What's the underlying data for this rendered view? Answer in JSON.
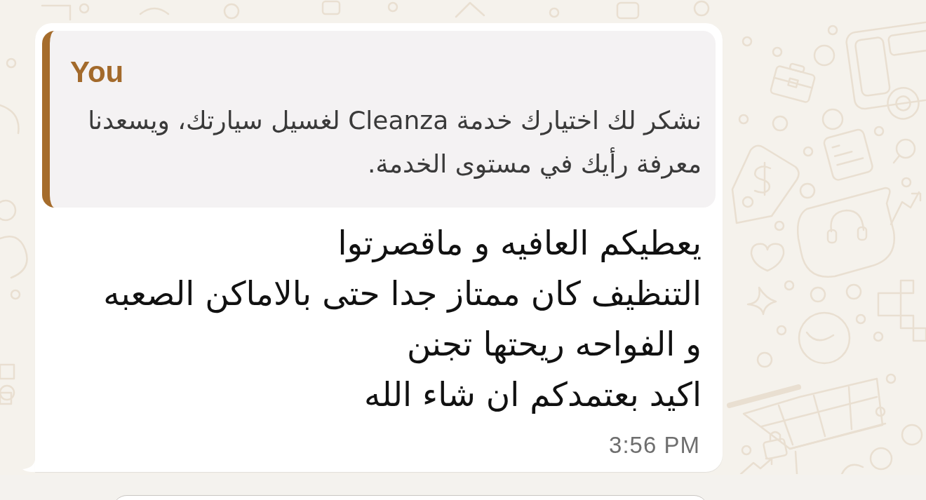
{
  "message": {
    "quote": {
      "author": "You",
      "text": "نشكر لك اختيارك خدمة Cleanza لغسيل سيارتك، ويسعدنا معرفة رأيك في مستوى الخدمة."
    },
    "text": "يعطيكم العافيه و ماقصرتوا\nالتنظيف كان ممتاز جدا حتى بالاماكن الصعبه\nو الفواحه ريحتها تجنن\nاكيد بعتمدكم ان شاء الله",
    "time": "3:56 PM"
  }
}
